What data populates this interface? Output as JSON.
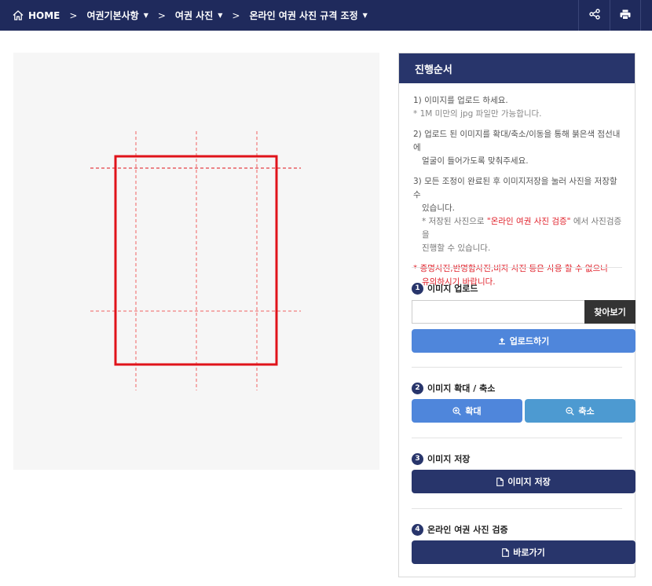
{
  "nav": {
    "home_label": "HOME",
    "crumb1": "여권기본사항",
    "crumb2": "여권 사진",
    "crumb3": "온라인 여권 사진 규격 조정",
    "separator": ">",
    "dropdown_glyph": "▼"
  },
  "panel": {
    "title": "진행순서",
    "steps": {
      "s1": "1) 이미지를 업로드 하세요.",
      "s1_note": "* 1M 미만의 jpg 파일만 가능합니다.",
      "s2_a": "2) 업로드 된 이미지를 확대/축소/이동을 통해 붉은색 점선내에",
      "s2_b": "얼굴이 들어가도록 맞춰주세요.",
      "s3_a": "3) 모든 조정이 완료된 후 이미지저장을 눌러 사진을 저장할 수",
      "s3_b": "있습니다.",
      "s3_note_pre": "* 저장된 사진으로 ",
      "s3_note_link": "\"온라인 여권 사진 검증\"",
      "s3_note_post": " 에서 사진검증을",
      "s3_note_2": "진행할 수 있습니다.",
      "warn_a": "* 증명사진,반명함사진,비자 사진 등은 사용 할 수 없으니",
      "warn_b": "유의하시기 바랍니다."
    },
    "sections": [
      {
        "num": "1",
        "title": "이미지 업로드"
      },
      {
        "num": "2",
        "title": "이미지 확대 / 축소"
      },
      {
        "num": "3",
        "title": "이미지 저장"
      },
      {
        "num": "4",
        "title": "온라인 여권 사진 검증"
      }
    ],
    "file_input_value": "",
    "browse_label": "찾아보기",
    "upload_label": "업로드하기",
    "zoom_in_label": "확대",
    "zoom_out_label": "축소",
    "save_label": "이미지 저장",
    "goto_label": "바로가기"
  },
  "colors": {
    "nav_bg": "#1f2a5c",
    "panel_head_bg": "#28356b",
    "upload_btn": "#4f86db",
    "zoom_out_btn": "#4d9ad1",
    "guide_frame": "#e0131a",
    "warning_text": "#e0202a"
  },
  "icons": [
    "home-icon",
    "share-icon",
    "print-icon",
    "upload-icon",
    "zoom-in-icon",
    "zoom-out-icon",
    "document-icon"
  ]
}
